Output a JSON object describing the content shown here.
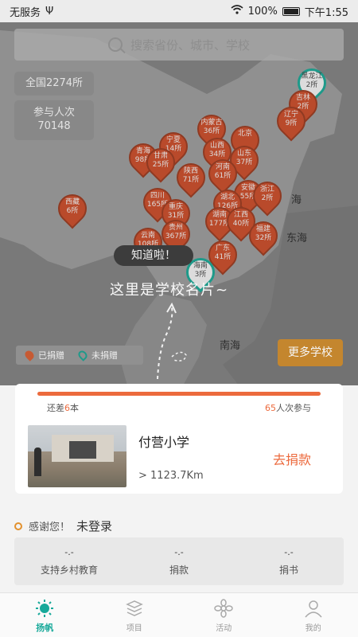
{
  "status_bar": {
    "carrier": "无服务",
    "usb": "Ψ",
    "battery": "100%",
    "time": "下午1:55"
  },
  "search": {
    "placeholder": "搜索省份、城市、学校"
  },
  "stats_overlay": {
    "total": "全国2274所",
    "participation_label": "参与人次",
    "participation_value": "70148"
  },
  "pins": [
    {
      "name": "黑龙江",
      "count": "2所",
      "state": "undonated"
    },
    {
      "name": "吉林",
      "count": "2所",
      "state": "donated"
    },
    {
      "name": "辽宁",
      "count": "9所",
      "state": "donated"
    },
    {
      "name": "内蒙古",
      "count": "36所",
      "state": "donated"
    },
    {
      "name": "北京",
      "count": "",
      "state": "donated"
    },
    {
      "name": "宁夏",
      "count": "14所",
      "state": "donated"
    },
    {
      "name": "山西",
      "count": "34所",
      "state": "donated"
    },
    {
      "name": "山东",
      "count": "37所",
      "state": "donated"
    },
    {
      "name": "青海",
      "count": "98所",
      "state": "donated"
    },
    {
      "name": "甘肃",
      "count": "25所",
      "state": "donated"
    },
    {
      "name": "陕西",
      "count": "71所",
      "state": "donated"
    },
    {
      "name": "河南",
      "count": "61所",
      "state": "donated"
    },
    {
      "name": "安徽",
      "count": "55所",
      "state": "donated"
    },
    {
      "name": "浙江",
      "count": "2所",
      "state": "donated"
    },
    {
      "name": "西藏",
      "count": "6所",
      "state": "donated"
    },
    {
      "name": "四川",
      "count": "165所",
      "state": "donated"
    },
    {
      "name": "重庆",
      "count": "31所",
      "state": "donated"
    },
    {
      "name": "湖北",
      "count": "126所",
      "state": "donated"
    },
    {
      "name": "湖南",
      "count": "177所",
      "state": "donated"
    },
    {
      "name": "江西",
      "count": "40所",
      "state": "donated"
    },
    {
      "name": "贵州",
      "count": "367所",
      "state": "donated"
    },
    {
      "name": "福建",
      "count": "32所",
      "state": "donated"
    },
    {
      "name": "云南",
      "count": "108所",
      "state": "donated"
    },
    {
      "name": "广东",
      "count": "41所",
      "state": "donated"
    },
    {
      "name": "海南",
      "count": "3所",
      "state": "undonated"
    }
  ],
  "seas": {
    "yellow_sea_partial": "海",
    "east_sea": "东海",
    "south_sea": "南海"
  },
  "tutorial": {
    "got_it": "知道啦！",
    "hint": "这里是学校名片~"
  },
  "legend": {
    "donated": "已捐赠",
    "undonated": "未捐赠"
  },
  "more_schools": "更多学校",
  "school_card": {
    "progress_fraction": 1.0,
    "diff_prefix": "还差",
    "diff_value": "6",
    "diff_suffix": "本",
    "participants_value": "65",
    "participants_suffix": "人次参与",
    "name": "付营小学",
    "distance": "> 1123.7Km",
    "donate": "去捐款"
  },
  "thanks": {
    "prefix": "感谢您！",
    "login": "未登录"
  },
  "user_stats": [
    {
      "value": "-.-",
      "label": "支持乡村教育"
    },
    {
      "value": "-.-",
      "label": "捐款"
    },
    {
      "value": "-.-",
      "label": "捐书"
    }
  ],
  "tabs": [
    {
      "label": "扬帆",
      "icon": "sail-icon",
      "active": true
    },
    {
      "label": "项目",
      "icon": "stack-icon",
      "active": false
    },
    {
      "label": "活动",
      "icon": "flower-icon",
      "active": false
    },
    {
      "label": "我的",
      "icon": "user-icon",
      "active": false
    }
  ],
  "colors": {
    "accent_orange": "#ec6a3d",
    "accent_teal": "#17a99a",
    "pin_red": "#b94a2b",
    "more_button": "#c4862e"
  }
}
